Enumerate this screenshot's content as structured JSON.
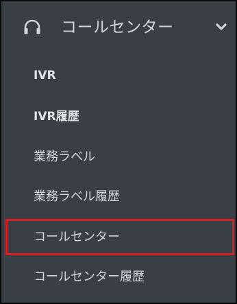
{
  "header": {
    "title": "コールセンター",
    "icon": "headset-icon",
    "expand_icon": "chevron-down-icon"
  },
  "menu": {
    "items": [
      {
        "label": "IVR"
      },
      {
        "label": "IVR履歴"
      },
      {
        "label": "業務ラベル"
      },
      {
        "label": "業務ラベル履歴"
      },
      {
        "label": "コールセンター",
        "highlighted": true
      },
      {
        "label": "コールセンター履歴"
      }
    ]
  },
  "colors": {
    "background": "#3a3f45",
    "text": "#d4d7da",
    "highlight_border": "#d91e24"
  }
}
